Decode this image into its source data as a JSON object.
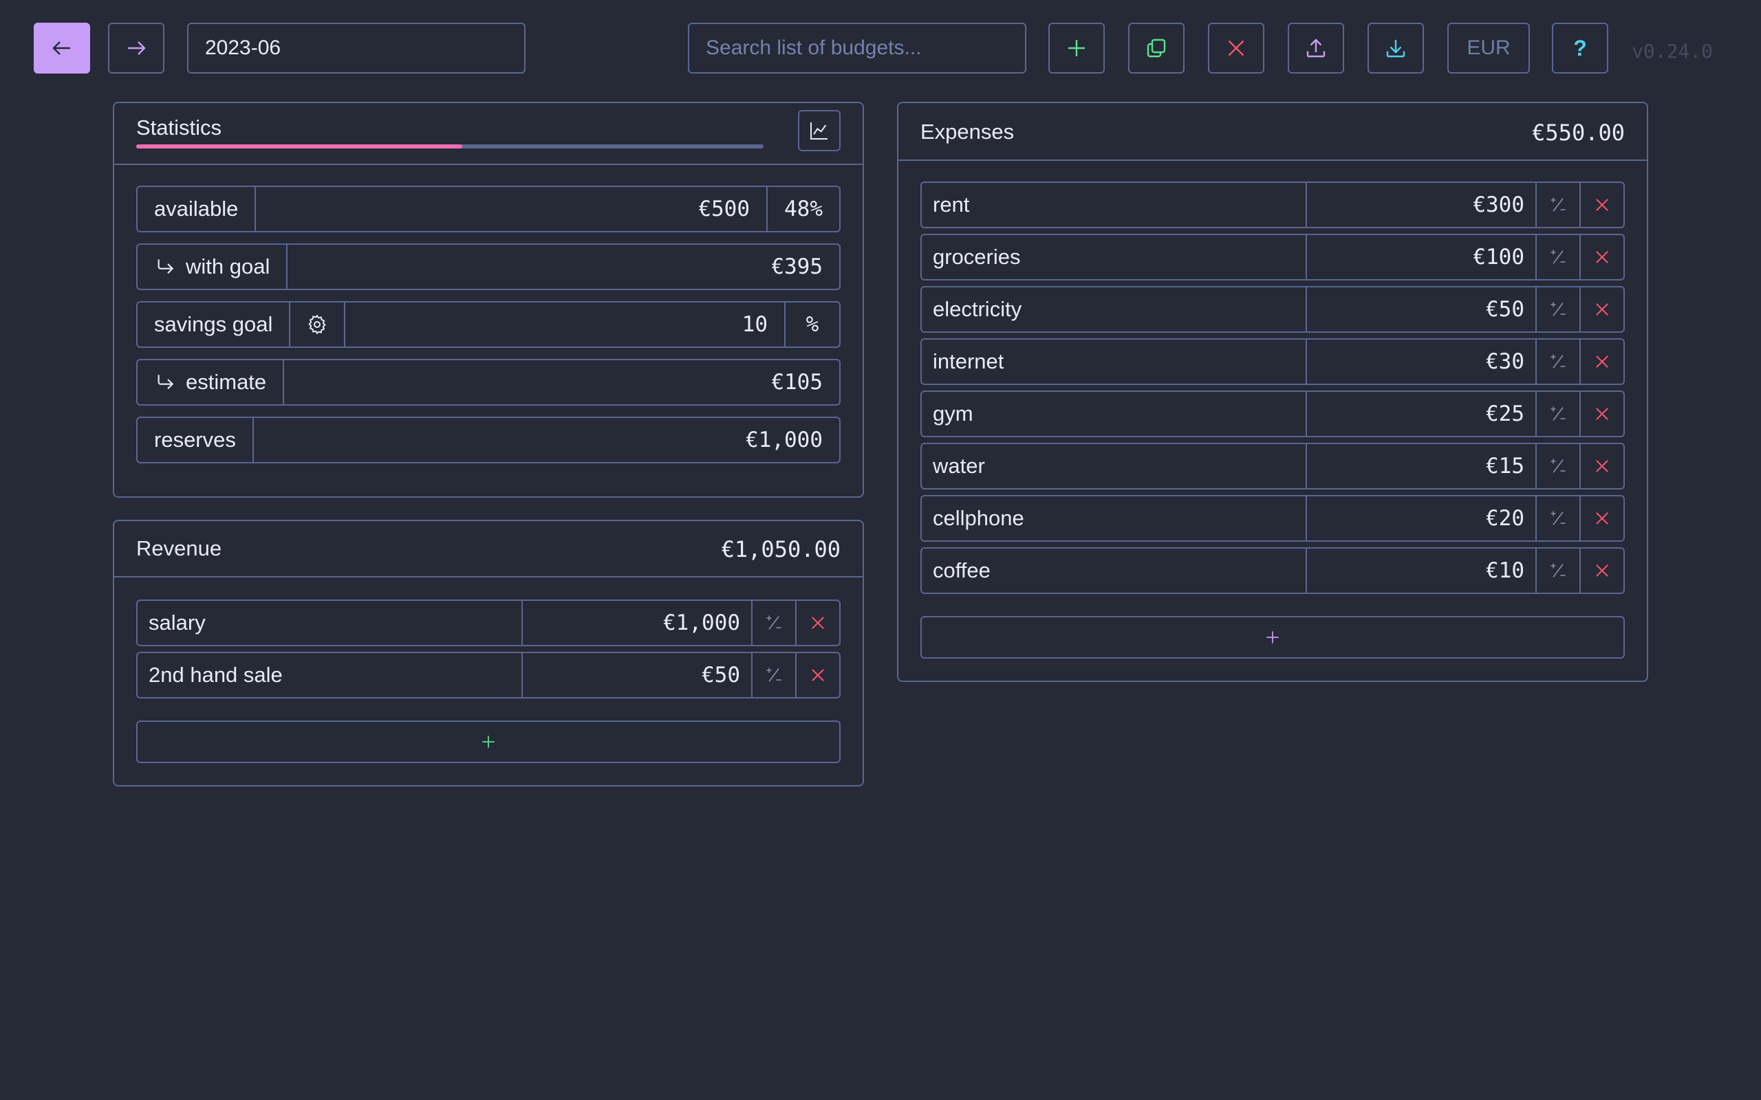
{
  "toolbar": {
    "date_value": "2023-06",
    "search_placeholder": "Search list of budgets...",
    "currency_label": "EUR",
    "help_label": "?",
    "version": "v0.24.0"
  },
  "colors": {
    "background": "#262936",
    "border": "#5a6690",
    "accent_purple": "#c69ef8",
    "green": "#5fe08f",
    "red": "#f0546a",
    "pink_progress": "#f06fb0",
    "cyan": "#4fd0f0"
  },
  "statistics": {
    "title": "Statistics",
    "progress_fraction": 0.52,
    "available": {
      "label": "available",
      "value": "€500",
      "percent": "48%"
    },
    "with_goal": {
      "label": "with goal",
      "value": "€395"
    },
    "savings_goal": {
      "label": "savings goal",
      "value": "10",
      "unit": "%"
    },
    "estimate": {
      "label": "estimate",
      "value": "€105"
    },
    "reserves": {
      "label": "reserves",
      "value": "€1,000"
    }
  },
  "revenue": {
    "title": "Revenue",
    "total": "€1,050.00",
    "items": [
      {
        "name": "salary",
        "amount": "€1,000"
      },
      {
        "name": "2nd hand sale",
        "amount": "€50"
      }
    ]
  },
  "expenses": {
    "title": "Expenses",
    "total": "€550.00",
    "items": [
      {
        "name": "rent",
        "amount": "€300"
      },
      {
        "name": "groceries",
        "amount": "€100"
      },
      {
        "name": "electricity",
        "amount": "€50"
      },
      {
        "name": "internet",
        "amount": "€30"
      },
      {
        "name": "gym",
        "amount": "€25"
      },
      {
        "name": "water",
        "amount": "€15"
      },
      {
        "name": "cellphone",
        "amount": "€20"
      },
      {
        "name": "coffee",
        "amount": "€10"
      }
    ]
  }
}
